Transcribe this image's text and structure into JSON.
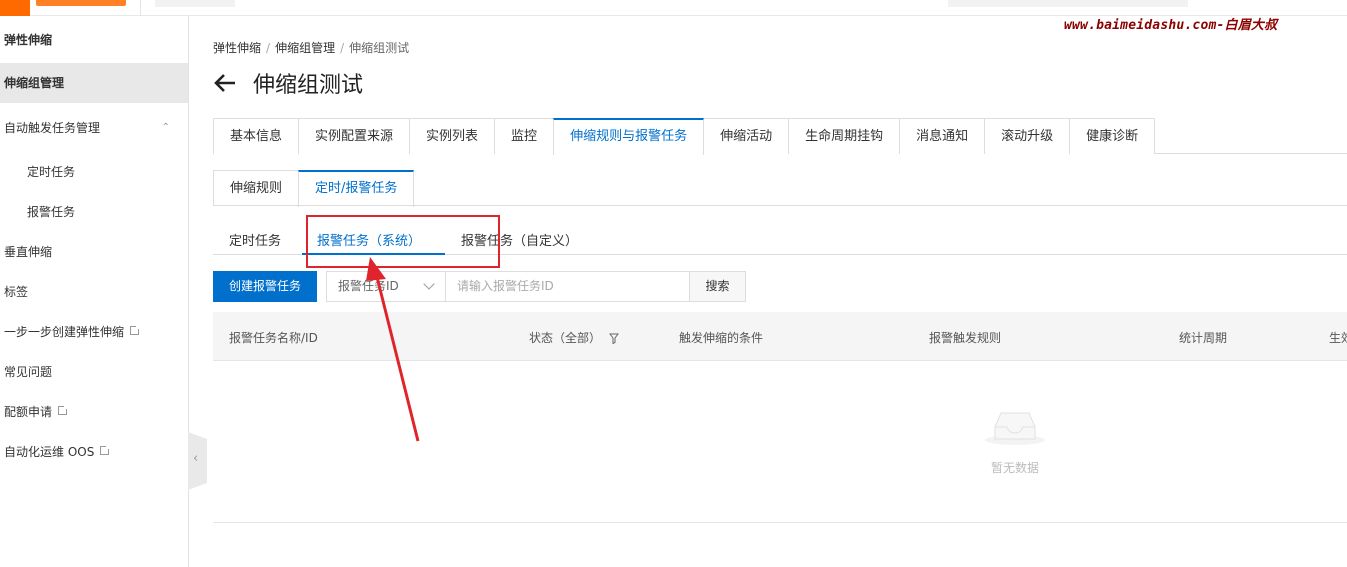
{
  "watermark": "www.baimeidashu.com-白眉大叔",
  "sidebar": {
    "header": "弹性伸缩",
    "items": [
      {
        "label": "伸缩组管理",
        "active": true
      },
      {
        "label": "自动触发任务管理"
      },
      {
        "label": "定时任务"
      },
      {
        "label": "报警任务"
      },
      {
        "label": "垂直伸缩"
      },
      {
        "label": "标签"
      },
      {
        "label": "一步一步创建弹性伸缩"
      },
      {
        "label": "常见问题"
      },
      {
        "label": "配额申请"
      },
      {
        "label": "自动化运维 OOS"
      }
    ]
  },
  "breadcrumb": [
    "弹性伸缩",
    "伸缩组管理",
    "伸缩组测试"
  ],
  "page_title": "伸缩组测试",
  "primary_tabs": [
    "基本信息",
    "实例配置来源",
    "实例列表",
    "监控",
    "伸缩规则与报警任务",
    "伸缩活动",
    "生命周期挂钩",
    "消息通知",
    "滚动升级",
    "健康诊断"
  ],
  "secondary_tabs": [
    "伸缩规则",
    "定时/报警任务"
  ],
  "tertiary_tabs": [
    "定时任务",
    "报警任务（系统）",
    "报警任务（自定义）"
  ],
  "toolbar": {
    "create_label": "创建报警任务",
    "select_value": "报警任务ID",
    "search_placeholder": "请输入报警任务ID",
    "search_label": "搜索"
  },
  "table": {
    "columns": [
      "报警任务名称/ID",
      "状态（全部）",
      "触发伸缩的条件",
      "报警触发规则",
      "统计周期",
      "生效"
    ],
    "empty_text": "暂无数据"
  },
  "colors": {
    "accent": "#0070cc",
    "brand": "#ff6a00",
    "annotation": "#e0242c"
  }
}
